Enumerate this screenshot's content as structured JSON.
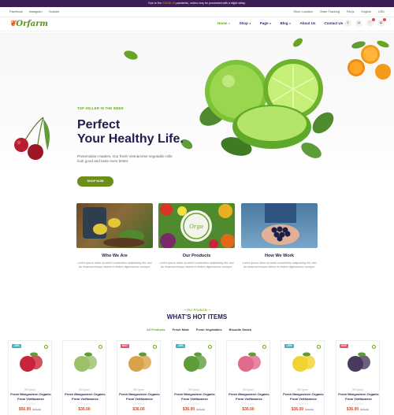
{
  "announcement": {
    "prefix": "Due to the",
    "highlight": "COVID-19",
    "suffix": "pandemic, orders may be processed with a slight delay."
  },
  "social": [
    "Facebook",
    "Instagram",
    "Youtube"
  ],
  "topbar_links": [
    "Store Location",
    "Order Tracking",
    "FAQs",
    "English",
    "USD"
  ],
  "brand": {
    "logo": "Orfarm",
    "accent": "#6aa425"
  },
  "nav": [
    {
      "label": "Home",
      "caret": true,
      "active": true
    },
    {
      "label": "Shop",
      "caret": true
    },
    {
      "label": "Page",
      "caret": true
    },
    {
      "label": "Blog",
      "caret": true
    },
    {
      "label": "About Us"
    },
    {
      "label": "Contact Us"
    }
  ],
  "header_icons": [
    "search-icon",
    "user-icon",
    "heart-icon",
    "cart-icon"
  ],
  "hero": {
    "tag": "TOP SELLER IN THE WEEK",
    "title_line1": "Perfect",
    "title_line2": "Your Healthy Life.",
    "description": "Presentation matters. Our fresh Vietnamese vegetable rolls look good and taste even better.",
    "button": "SHOP NOW"
  },
  "features": [
    {
      "title": "Who We Are",
      "text": "Lorem ipsum dolor sit amet consectetur adipisicing elit, sed do eiusmod tempor labore et dolore dignissimos cumque."
    },
    {
      "title": "Our Products",
      "text": "Lorem ipsum dolor sit amet consectetur adipisicing elit, sed do eiusmod tempor labore et dolore dignissimos cumque."
    },
    {
      "title": "How We Work",
      "text": "Lorem ipsum dolor sit amet consectetur adipisicing elit, sed do eiusmod tempor labore et dolore dignissimos cumque."
    }
  ],
  "hot": {
    "subtitle": "~ Our Products ~",
    "title": "WHAT'S HOT ITEMS",
    "tabs": [
      "All Products",
      "Fresh Meat",
      "Fresh Vegetables",
      "Biscuits Snack"
    ]
  },
  "products": [
    {
      "tag": "-15%",
      "tag_color": "#3cb6c6",
      "weight": "500 gram",
      "name": "Fresh Mangosteen Organic From VietNamese",
      "price": "$56.00",
      "old": "$70.00",
      "color": "#c8243a"
    },
    {
      "tag": "",
      "tag_color": "",
      "weight": "500 gram",
      "name": "Fresh Mangosteen Organic From VietNamese",
      "price": "$36.00",
      "old": "",
      "color": "#9bc06a"
    },
    {
      "tag": "HOT",
      "tag_color": "#e5546a",
      "weight": "500 gram",
      "name": "Fresh Mangosteen Organic From VietNamese",
      "price": "$36.00",
      "old": "",
      "color": "#d9a24a"
    },
    {
      "tag": "-15%",
      "tag_color": "#3cb6c6",
      "weight": "500 gram",
      "name": "Fresh Mangosteen Organic From VietNamese",
      "price": "$36.00",
      "old": "$70.00",
      "color": "#5e9c3a"
    },
    {
      "tag": "",
      "tag_color": "",
      "weight": "500 gram",
      "name": "Fresh Mangosteen Organic From VietNamese",
      "price": "$36.00",
      "old": "",
      "color": "#e06a8a"
    },
    {
      "tag": "-15%",
      "tag_color": "#3cb6c6",
      "weight": "500 gram",
      "name": "Fresh Mangosteen Organic From VietNamese",
      "price": "$36.00",
      "old": "$70.00",
      "color": "#f2d230"
    },
    {
      "tag": "HOT",
      "tag_color": "#e5546a",
      "weight": "500 gram",
      "name": "Fresh Mangosteen Organic From VietNamese",
      "price": "$36.00",
      "old": "$70.00",
      "color": "#4a3a5e"
    }
  ]
}
